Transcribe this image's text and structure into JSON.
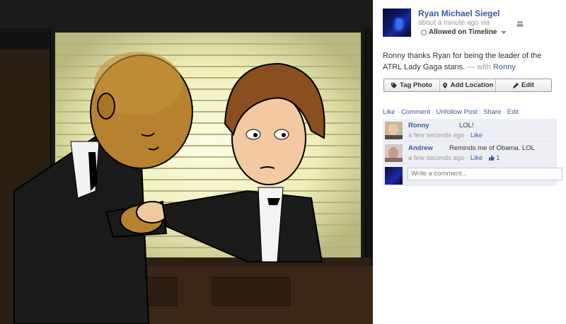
{
  "post": {
    "author": "Ryan Michael Siegel",
    "meta": "about a minute ago via",
    "audience": "Allowed on Timeline",
    "caption_main": "Ronny thanks Ryan for being the leader of the ATRL Lady Gaga stans.",
    "caption_with_prefix": " — with ",
    "caption_with_name": "Ronny"
  },
  "buttons": {
    "tag_photo": "Tag Photo",
    "add_location": "Add Location",
    "edit": "Edit"
  },
  "actions": {
    "like": "Like",
    "comment": "Comment",
    "unfollow": "Unfollow Post",
    "share": "Share",
    "edit": "Edit",
    "sep": " · "
  },
  "comments": [
    {
      "name": "Ronny",
      "text": "LOL!",
      "time": "a few seconds ago",
      "like": "Like"
    },
    {
      "name": "Andrew",
      "text": "Reminds me of Obama. LOL",
      "time": "a few seconds ago",
      "like": "Like",
      "likes_count": "1"
    }
  ],
  "composer": {
    "placeholder": "Write a comment..."
  },
  "icons": [
    "people-icon",
    "globe-icon",
    "tag-icon",
    "location-pin-icon",
    "pencil-icon",
    "thumbs-up-icon"
  ],
  "colors": {
    "link": "#3b5998",
    "comment_bg": "#edeff4",
    "stage_bg": "#0d0d0d"
  }
}
